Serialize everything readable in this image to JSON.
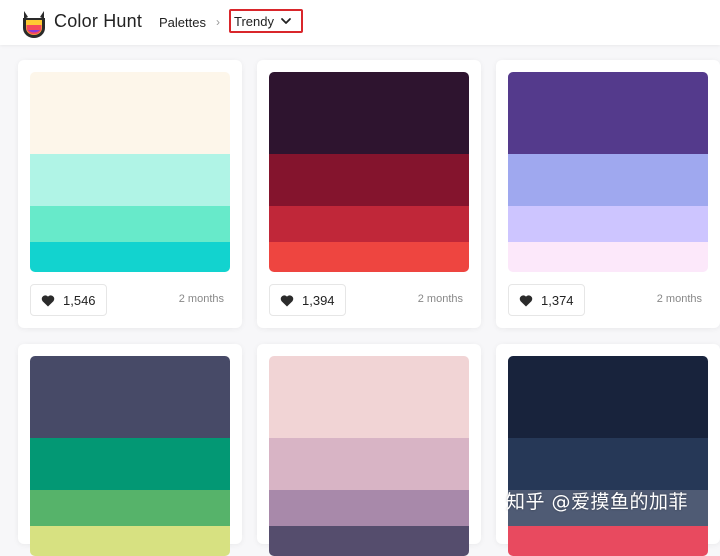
{
  "header": {
    "brand": "Color Hunt",
    "nav_palettes": "Palettes",
    "breadcrumb_separator": "›",
    "nav_trendy": "Trendy",
    "icons": {
      "logo": "color-hunt-logo-icon",
      "chevron": "chevron-down-icon"
    }
  },
  "cards": [
    {
      "colors": [
        "#FDF6EA",
        "#B0F4E6",
        "#67EACA",
        "#12D3CF"
      ],
      "likes": "1,546",
      "age": "2 months"
    },
    {
      "colors": [
        "#2E142F",
        "#84142D",
        "#C02739",
        "#EE4540"
      ],
      "likes": "1,394",
      "age": "2 months"
    },
    {
      "colors": [
        "#543A8C",
        "#9FA8EF",
        "#CDC5FF",
        "#FCE8FA"
      ],
      "likes": "1,374",
      "age": "2 months"
    },
    {
      "colors": [
        "#474A67",
        "#039874",
        "#56B36A",
        "#D7E181"
      ],
      "likes": "",
      "age": ""
    },
    {
      "colors": [
        "#F1D4D5",
        "#D8B4C5",
        "#A889AA",
        "#554D6D"
      ],
      "likes": "",
      "age": ""
    },
    {
      "colors": [
        "#18233C",
        "#263857",
        "#4F5B74",
        "#E84A5F"
      ],
      "likes": "",
      "age": ""
    }
  ],
  "watermark": "知乎 @爱摸鱼的加菲"
}
